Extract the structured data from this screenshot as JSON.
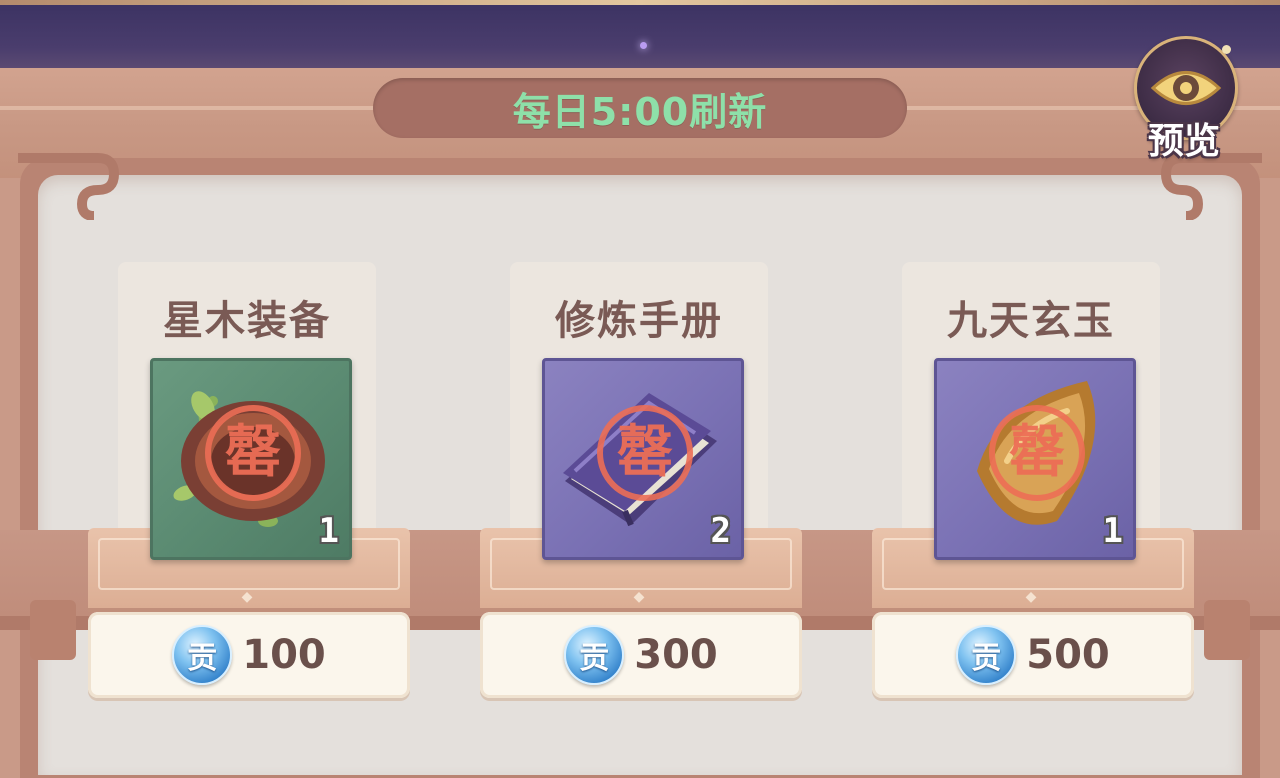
{
  "header": {
    "refresh_text": "每日5:00刷新",
    "preview_label": "预览"
  },
  "shop": {
    "currency_icon": "contribution-coin-icon",
    "currency_glyph": "贡",
    "items": [
      {
        "name": "星木装备",
        "quantity": "1",
        "price": "100",
        "stamp": "罄",
        "icon": "wood-equipment-icon",
        "slot_color": "#5a8a71"
      },
      {
        "name": "修炼手册",
        "quantity": "2",
        "price": "300",
        "stamp": "罄",
        "icon": "cultivation-book-icon",
        "slot_color": "#7a71b4"
      },
      {
        "name": "九天玄玉",
        "quantity": "1",
        "price": "500",
        "stamp": "罄",
        "icon": "jade-gem-icon",
        "slot_color": "#7a71b4"
      }
    ]
  }
}
